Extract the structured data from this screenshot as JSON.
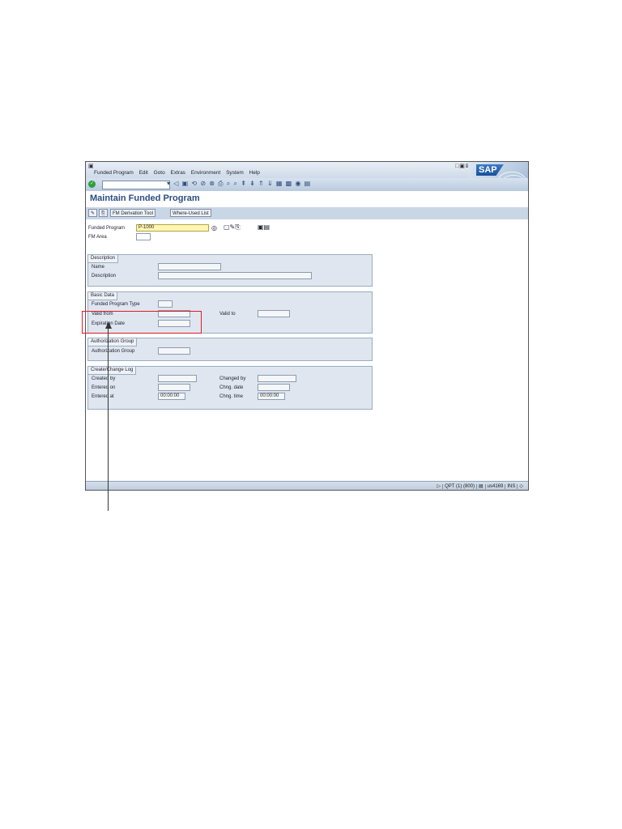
{
  "window": {
    "menu": [
      "Funded Program",
      "Edit",
      "Goto",
      "Extras",
      "Environment",
      "System",
      "Help"
    ],
    "sap_logo": "SAP",
    "title": "Maintain Funded Program"
  },
  "app_toolbar": {
    "fm_derivation_tool": "FM Derivation Tool",
    "where_used_list": "Where-Used List"
  },
  "header_fields": {
    "funded_program_label": "Funded Program",
    "funded_program_value": "P-1000",
    "fm_area_label": "FM Area",
    "fm_area_value": ""
  },
  "description_group": {
    "title": "Description",
    "name_label": "Name",
    "description_label": "Description"
  },
  "basic_data_group": {
    "title": "Basic Data",
    "funded_program_type_label": "Funded Program Type",
    "valid_from_label": "Valid from",
    "valid_to_label": "Valid to",
    "expiration_date_label": "Expiration Date"
  },
  "auth_group": {
    "title": "Authorization Group",
    "authorization_group_label": "Authorization Group"
  },
  "change_log_group": {
    "title": "Create/Change Log",
    "created_by_label": "Created by",
    "entered_on_label": "Entered on",
    "entered_at_label": "Entered at",
    "entered_at_value": "00:00:00",
    "changed_by_label": "Changed by",
    "chng_date_label": "Chng. date",
    "chng_time_label": "Chng. time",
    "chng_time_value": "00:00:00"
  },
  "status_bar": {
    "system": "QPT (1) (800)",
    "server": "us4169",
    "mode": "INS"
  },
  "colors": {
    "title": "#2a4d7f",
    "highlight": "#e21b24",
    "required_field": "#fff6b3",
    "group_bg": "#dfe6ef"
  },
  "icons": [
    "check-icon",
    "save-icon",
    "back-icon",
    "exit-icon",
    "cancel-icon",
    "print-icon",
    "find-icon",
    "help-icon"
  ]
}
